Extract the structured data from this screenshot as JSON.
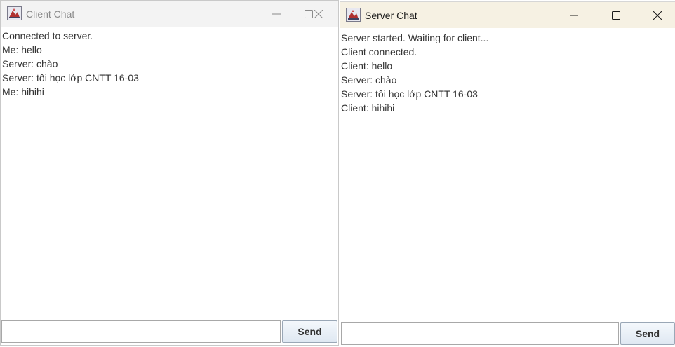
{
  "client": {
    "title": "Client Chat",
    "icon": "java-app-icon",
    "messages": [
      "Connected to server.",
      "Me: hello",
      "Server: chào",
      "Server: tôi học lớp CNTT 16-03",
      "Me: hihihi"
    ],
    "input_value": "",
    "send_label": "Send"
  },
  "server": {
    "title": "Server Chat",
    "icon": "java-app-icon",
    "messages": [
      "Server started. Waiting for client...",
      "Client connected.",
      "Client: hello",
      "Server: chào",
      "Server: tôi học lớp CNTT 16-03",
      "Client: hihihi"
    ],
    "input_value": "",
    "send_label": "Send"
  },
  "colors": {
    "inactive_titlebar": "#f3f3f3",
    "active_titlebar": "#f6f1e3",
    "inactive_title_text": "#8a8a8a",
    "active_title_text": "#1a1a1a",
    "text": "#333333"
  }
}
